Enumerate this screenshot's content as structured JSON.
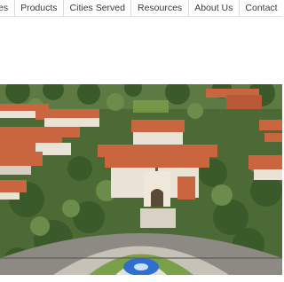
{
  "nav": {
    "items": [
      {
        "label": "es"
      },
      {
        "label": "Products"
      },
      {
        "label": "Cities Served"
      },
      {
        "label": "Resources"
      },
      {
        "label": "About Us"
      },
      {
        "label": "Contact"
      }
    ]
  },
  "hero": {
    "image": "aerial-campus-photo",
    "colors": {
      "roof": "#c9653f",
      "wall": "#e9e2d6",
      "tree": "#3f6a2e",
      "lawn": "#7aa04a",
      "road": "#8d8a84",
      "fountain": "#2f6fd0"
    }
  }
}
